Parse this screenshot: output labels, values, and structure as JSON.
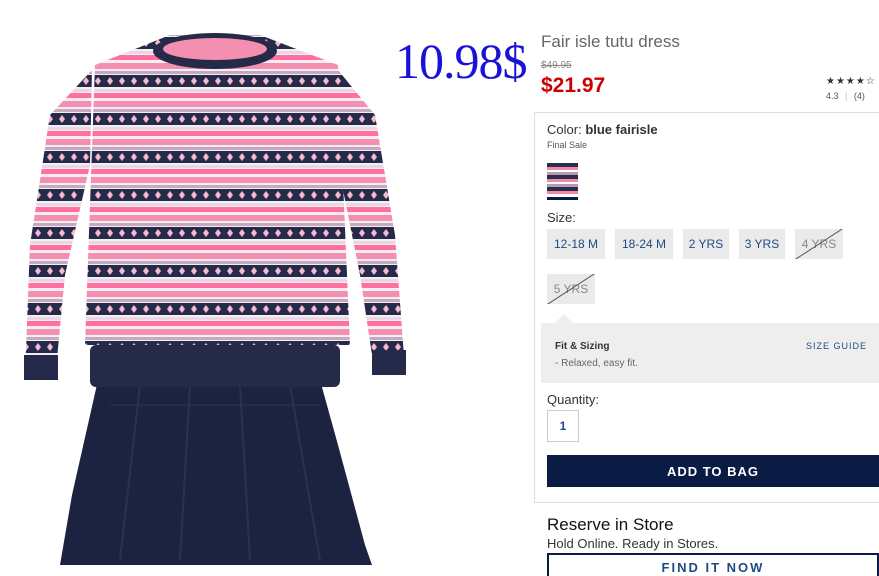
{
  "overlay_price": "10.98$",
  "product": {
    "title": "Fair isle tutu dress",
    "old_price": "$49.95",
    "new_price": "$21.97"
  },
  "rating": {
    "stars": "★★★★☆",
    "score": "4.3",
    "count": "(4)"
  },
  "color": {
    "label": "Color:",
    "value": "blue fairisle",
    "note": "Final Sale"
  },
  "size": {
    "label": "Size:",
    "options": [
      {
        "label": "12-18 M",
        "available": true
      },
      {
        "label": "18-24 M",
        "available": true
      },
      {
        "label": "2 YRS",
        "available": true
      },
      {
        "label": "3 YRS",
        "available": true
      },
      {
        "label": "4 YRS",
        "available": false
      },
      {
        "label": "5 YRS",
        "available": false
      }
    ]
  },
  "fit": {
    "title": "Fit & Sizing",
    "description": "- Relaxed, easy fit.",
    "guide_link": "SIZE GUIDE"
  },
  "quantity": {
    "label": "Quantity:",
    "value": "1"
  },
  "add_to_bag": "ADD TO BAG",
  "reserve": {
    "title": "Reserve in Store",
    "subtitle": "Hold Online. Ready in Stores.",
    "button": "FIND IT NOW"
  },
  "colors": {
    "price_red": "#cc0000",
    "navy": "#0a1b44",
    "link_blue": "#1e4a86",
    "overlay_blue": "#1a13d6"
  }
}
